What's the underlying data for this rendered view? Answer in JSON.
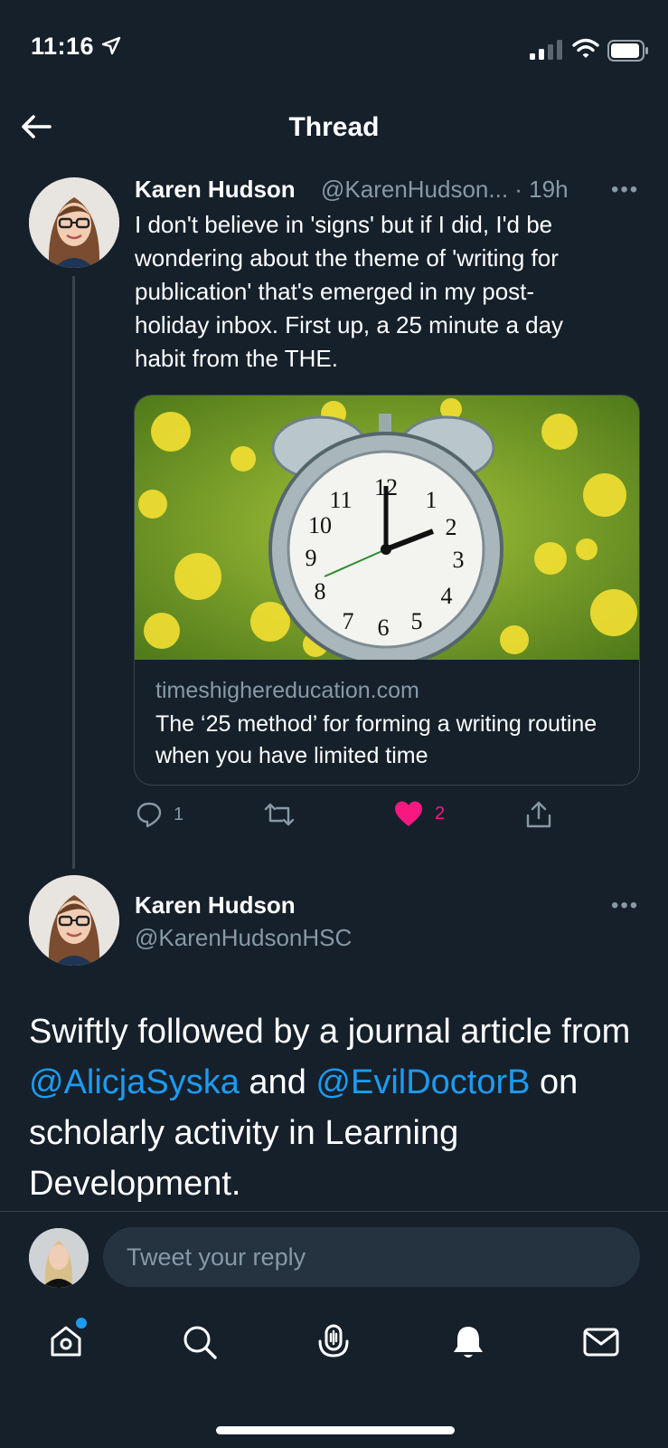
{
  "status_bar": {
    "time": "11:16"
  },
  "header": {
    "title": "Thread"
  },
  "tweet1": {
    "name": "Karen Hudson",
    "handle_time": "@KarenHudson... · 19h",
    "lines": [
      "I don't believe in 'signs' but if I did, I'd be",
      "wondering about the theme of 'writing for",
      "publication' that's emerged in my post-",
      "holiday inbox. First up, a 25 minute a day",
      "habit from the THE."
    ],
    "card": {
      "domain": "timeshighereducation.com",
      "title": "The ‘25 method’ for forming a writing routine when you have limited time"
    },
    "actions": {
      "replies": "1",
      "likes": "2"
    }
  },
  "tweet2": {
    "name": "Karen Hudson",
    "handle": "@KarenHudsonHSC",
    "text_parts": {
      "p1": "Swiftly followed by a journal article from ",
      "m1": "@AlicjaSyska",
      "p2": " and ",
      "m2": "@EvilDoctorB",
      "p3": " on scholarly activity in Learning Development."
    }
  },
  "reply": {
    "placeholder": "Tweet your reply"
  },
  "colors": {
    "background": "#15202b",
    "accent": "#1d9bf0",
    "like": "#f91880",
    "muted": "#8899a6"
  },
  "icons": [
    "location-arrow-icon",
    "signal-icon",
    "wifi-icon",
    "battery-icon",
    "back-arrow-icon",
    "more-icon",
    "reply-icon",
    "retweet-icon",
    "heart-icon",
    "share-icon",
    "home-icon",
    "search-icon",
    "spaces-icon",
    "notifications-icon",
    "messages-icon"
  ]
}
